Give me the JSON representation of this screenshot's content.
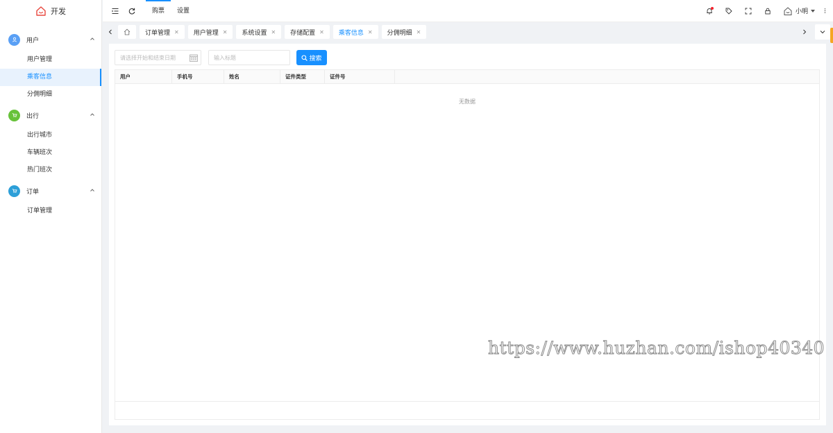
{
  "app": {
    "logo_text": "开发",
    "accent": "#1890ff"
  },
  "sidebar": {
    "groups": [
      {
        "label": "用户",
        "icon": "user-icon",
        "color": "#5aa0f5",
        "items": [
          {
            "label": "用户管理"
          },
          {
            "label": "乘客信息",
            "active": true
          },
          {
            "label": "分佣明细"
          }
        ]
      },
      {
        "label": "出行",
        "icon": "cart-icon",
        "color": "#67c23a",
        "items": [
          {
            "label": "出行城市"
          },
          {
            "label": "车辆班次"
          },
          {
            "label": "热门班次"
          }
        ]
      },
      {
        "label": "订单",
        "icon": "cart-icon",
        "color": "#2d9fd8",
        "items": [
          {
            "label": "订单管理"
          }
        ]
      }
    ]
  },
  "topbar": {
    "nav": [
      {
        "label": "购票",
        "active": true
      },
      {
        "label": "设置"
      }
    ],
    "user_name": "小明"
  },
  "tabs": [
    {
      "label": "订单管理"
    },
    {
      "label": "用户管理"
    },
    {
      "label": "系统设置"
    },
    {
      "label": "存储配置"
    },
    {
      "label": "乘客信息",
      "active": true
    },
    {
      "label": "分佣明细"
    }
  ],
  "filters": {
    "date_placeholder": "请选择开始和结束日期",
    "title_placeholder": "输入标题",
    "search_label": "搜索"
  },
  "table": {
    "columns": [
      "用户",
      "手机号",
      "姓名",
      "证件类型",
      "证件号"
    ],
    "empty_text": "无数据"
  },
  "watermark": "https://www.huzhan.com/ishop40340"
}
